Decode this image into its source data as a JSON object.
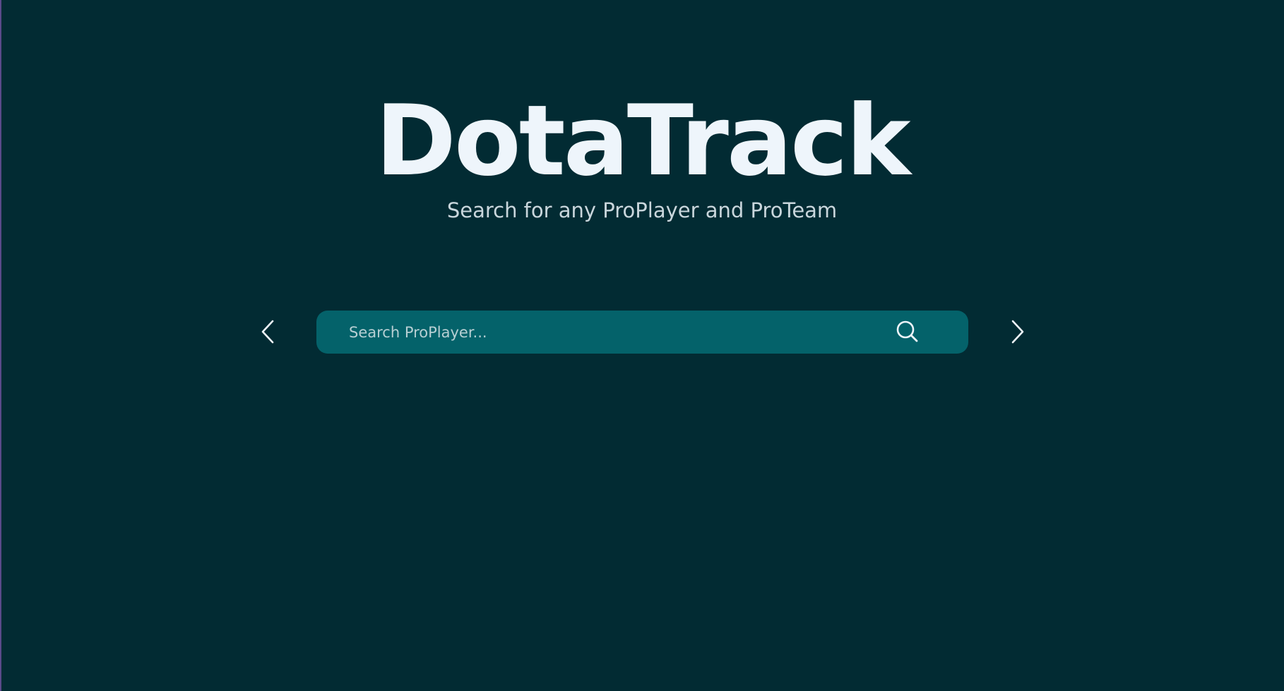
{
  "header": {
    "brand": "DotaTrack",
    "subtitle": "Search for any ProPlayer and ProTeam"
  },
  "search": {
    "placeholder": "Search ProPlayer...",
    "value": "",
    "icon": "search-icon"
  },
  "nav": {
    "prev_icon": "chevron-left-icon",
    "next_icon": "chevron-right-icon"
  },
  "colors": {
    "background": "#022b33",
    "search_bar": "#04626a",
    "title_text": "#eef5fb",
    "subtitle_text": "#c9d6dc"
  }
}
